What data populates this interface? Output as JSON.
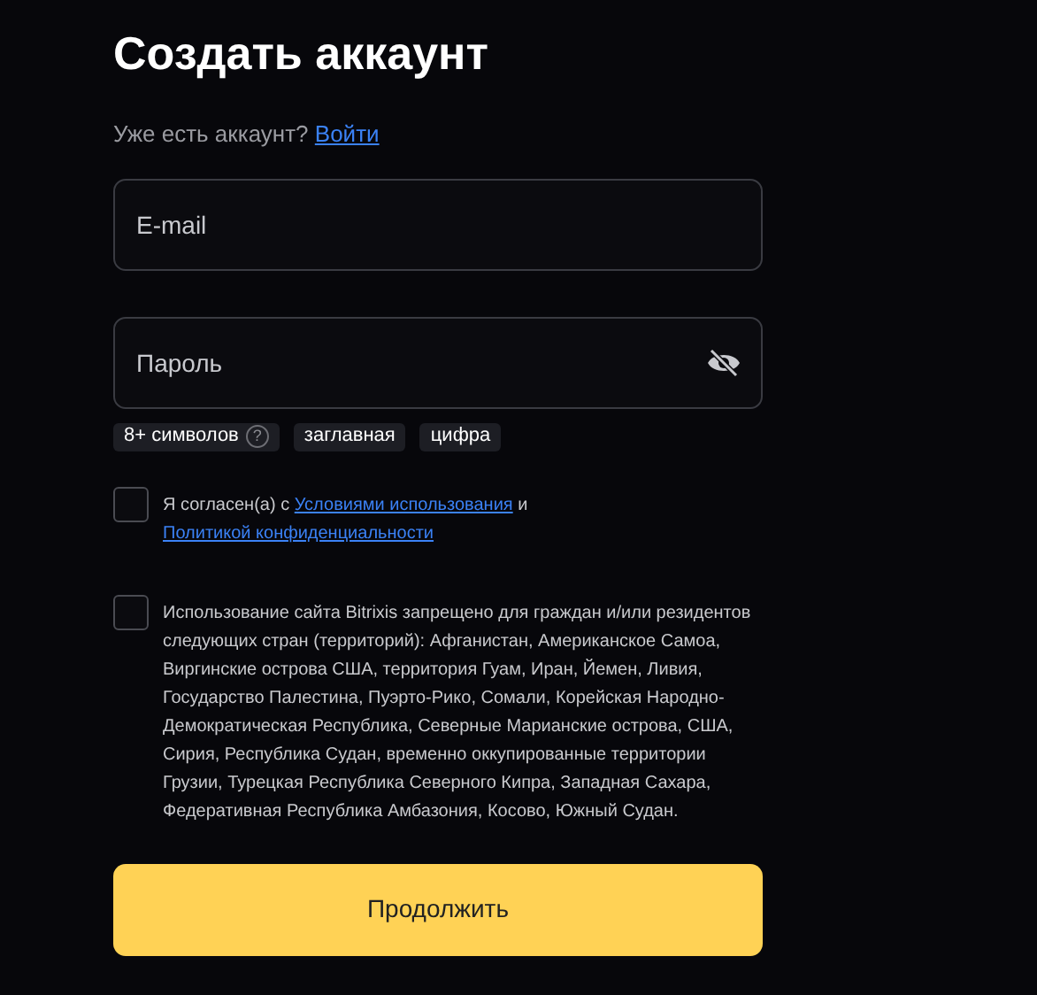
{
  "title": "Создать аккаунт",
  "login_prompt": {
    "text": "Уже есть аккаунт?",
    "link": "Войти"
  },
  "fields": [
    {
      "placeholder": "E-mail",
      "kind": "text"
    },
    {
      "placeholder": "Пароль",
      "kind": "password"
    }
  ],
  "requirements": [
    {
      "label": "8+ символов",
      "help": "?"
    },
    {
      "label": "заглавная"
    },
    {
      "label": "цифра"
    }
  ],
  "agreements": [
    {
      "checked": false,
      "parts": [
        {
          "text": "Я согласен(а) с "
        },
        {
          "link": "Условиями использования"
        },
        {
          "text": " и "
        },
        {
          "link": "Политикой конфиденциальности"
        }
      ]
    },
    {
      "checked": false,
      "parts": [
        {
          "text": "Использование сайта Bitrixis запрещено для граждан и/или резидентов следующих стран (территорий): Афганистан, Американское Самоа, Виргинские острова США, территория Гуам, Иран, Йемен, Ливия, Государство Палестина, Пуэрто-Рико, Сомали, Корейская Народно-Демократическая Республика, Северные Марианские острова, США, Сирия, Республика Судан, временно оккупированные территории Грузии, Турецкая Республика Северного Кипра, Западная Сахара, Федеративная Республика Амбазония, Косово, Южный Судан."
        }
      ]
    }
  ],
  "submit": "Продолжить"
}
